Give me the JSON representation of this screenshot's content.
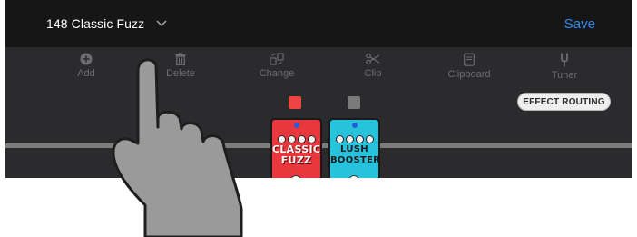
{
  "header": {
    "preset_name": "148 Classic Fuzz",
    "save_label": "Save"
  },
  "toolbar": {
    "items": [
      {
        "label": "Add",
        "icon": "add-icon"
      },
      {
        "label": "Delete",
        "icon": "trash-icon"
      },
      {
        "label": "Change",
        "icon": "change-icon"
      },
      {
        "label": "Clip",
        "icon": "scissors-icon"
      },
      {
        "label": "Clipboard",
        "icon": "clipboard-icon"
      },
      {
        "label": "Tuner",
        "icon": "tuning-fork-icon"
      }
    ]
  },
  "effect_routing_label": "EFFECT ROUTING",
  "pedals": [
    {
      "name_line1": "CLASSIC",
      "name_line2": "FUZZ",
      "color": "#e8383d",
      "selector_color": "#ee4444"
    },
    {
      "name_line1": "LUSH",
      "name_line2": "BOOSTER",
      "color": "#27c3dd",
      "selector_color": "#7a7a7a"
    }
  ],
  "colors": {
    "accent": "#2d8cf0",
    "background": "#2b2b2d",
    "topbar": "#161617"
  }
}
